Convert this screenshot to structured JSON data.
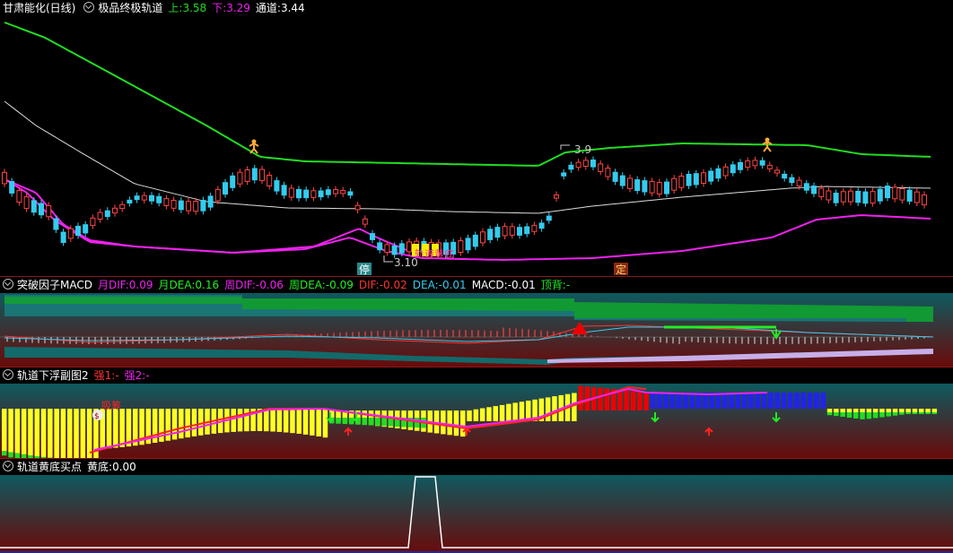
{
  "main": {
    "stock": "甘肃能化(日线)",
    "indicator": "极品终极轨道",
    "up_label": "上:",
    "up_value": "3.58",
    "down_label": "下:",
    "down_value": "3.29",
    "channel_label": "通道:",
    "channel_value": "3.44",
    "price_high": "3.9",
    "price_low": "3.10",
    "tag_stop": "停",
    "tag_fix": "定",
    "annotation": "轨道黄底"
  },
  "macd": {
    "title": "突破因子MACD",
    "m_dif_label": "月DIF:",
    "m_dif": "0.09",
    "m_dea_label": "月DEA:",
    "m_dea": "0.16",
    "w_dif_label": "周DIF:",
    "w_dif": "-0.06",
    "w_dea_label": "周DEA:",
    "w_dea": "-0.09",
    "dif_label": "DIF:",
    "dif": "-0.02",
    "dea_label": "DEA:",
    "dea": "-0.01",
    "macd_label": "MACD:",
    "macd": "-0.01",
    "top_label": "顶背:",
    "top": "-"
  },
  "float": {
    "title": "轨道下浮副图2",
    "q1_label": "强1:",
    "q1": "-",
    "q2_label": "强2:",
    "q2": "-",
    "marker": "吸筹"
  },
  "bottom": {
    "title": "轨道黄底买点",
    "label": "黄底:",
    "value": "0.00"
  },
  "colors": {
    "up_rail": "#22dd22",
    "down_rail": "#ee22ee",
    "mid_rail": "#dddddd",
    "candle_up": "#ff4444",
    "candle_down": "#33ccee"
  }
}
